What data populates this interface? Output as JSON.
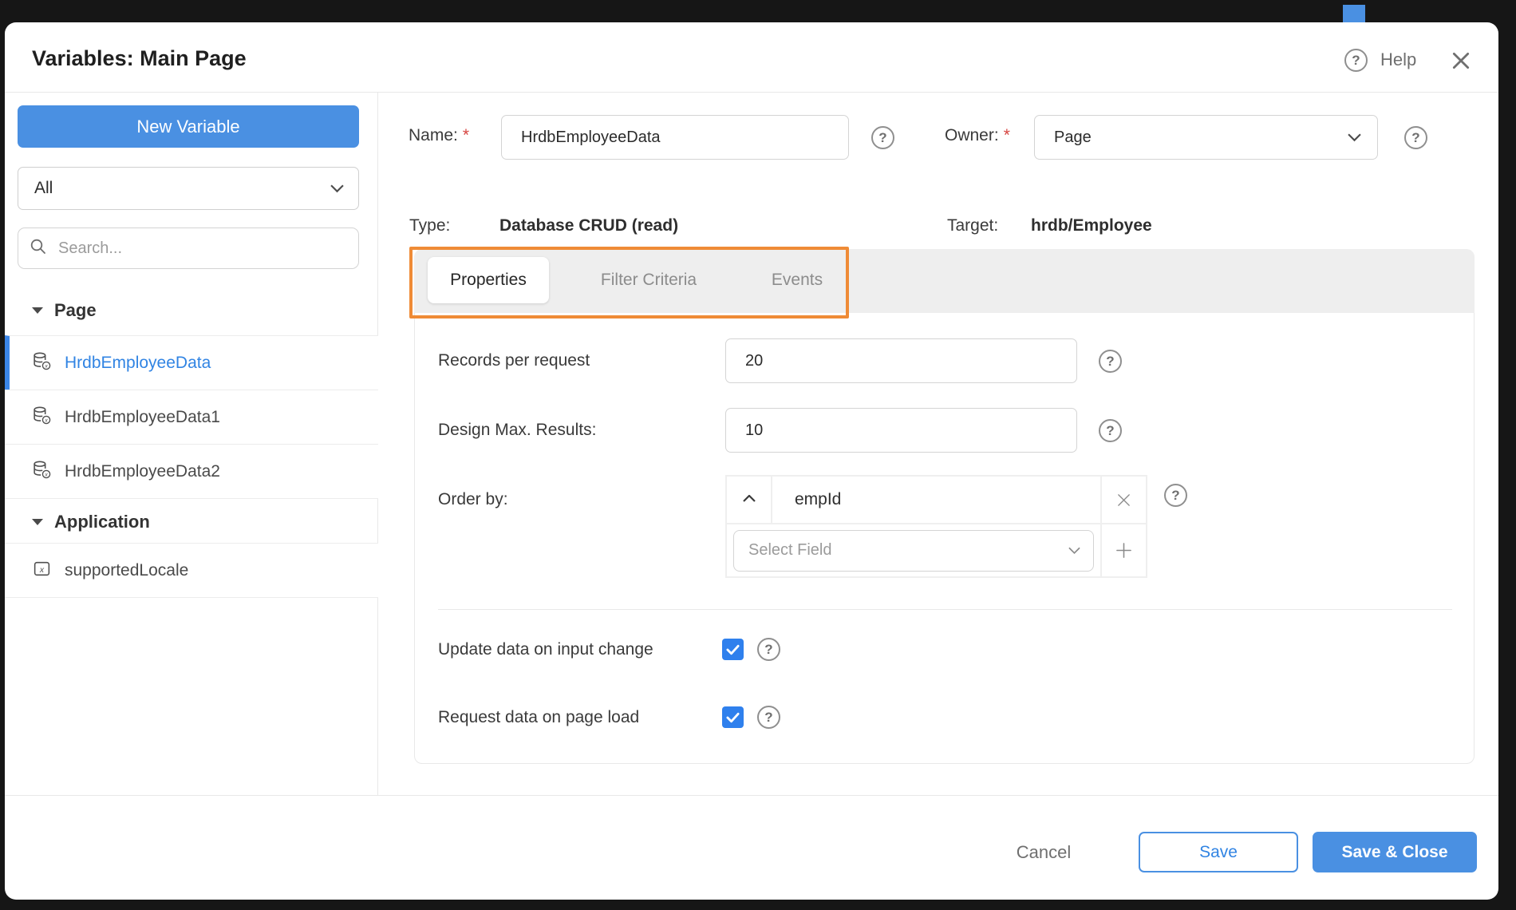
{
  "dialog": {
    "title": "Variables: Main Page",
    "help_label": "Help"
  },
  "icons": {
    "help_glyph": "?"
  },
  "sidebar": {
    "new_variable_button": "New Variable",
    "filter_selected_value": "All",
    "search_placeholder": "Search...",
    "sections": [
      {
        "label": "Page",
        "items": [
          {
            "label": "HrdbEmployeeData",
            "icon": "database-variable-icon",
            "selected": true
          },
          {
            "label": "HrdbEmployeeData1",
            "icon": "database-variable-icon",
            "selected": false
          },
          {
            "label": "HrdbEmployeeData2",
            "icon": "database-variable-icon",
            "selected": false
          }
        ]
      },
      {
        "label": "Application",
        "items": [
          {
            "label": "supportedLocale",
            "icon": "model-variable-icon",
            "selected": false
          }
        ]
      }
    ]
  },
  "form": {
    "required_marker": "*",
    "name_label": "Name:",
    "name_value": "HrdbEmployeeData",
    "owner_label": "Owner:",
    "owner_value": "Page",
    "type_label": "Type:",
    "type_value": "Database CRUD (read)",
    "target_label": "Target:",
    "target_value": "hrdb/Employee"
  },
  "tabs": [
    {
      "label": "Properties",
      "active": true
    },
    {
      "label": "Filter Criteria",
      "active": false
    },
    {
      "label": "Events",
      "active": false
    }
  ],
  "properties": {
    "records_per_request": {
      "label": "Records per request",
      "value": "20"
    },
    "design_max_results": {
      "label": "Design Max. Results:",
      "value": "10"
    },
    "order_by": {
      "label": "Order by:",
      "field_value": "empId",
      "select_placeholder": "Select Field"
    },
    "checkboxes": [
      {
        "label": "Update data on input change",
        "checked": true
      },
      {
        "label": "Request data on page load",
        "checked": true
      }
    ]
  },
  "footer": {
    "cancel_label": "Cancel",
    "save_label": "Save",
    "save_close_label": "Save & Close"
  },
  "colors": {
    "accent_blue": "#4a90e2",
    "selected_item_blue": "#3184e3",
    "checkbox_blue": "#2f80ed",
    "annotation_orange": "#ef8b36",
    "tabbar_gray": "#eeeeee",
    "backdrop": "#161616"
  }
}
